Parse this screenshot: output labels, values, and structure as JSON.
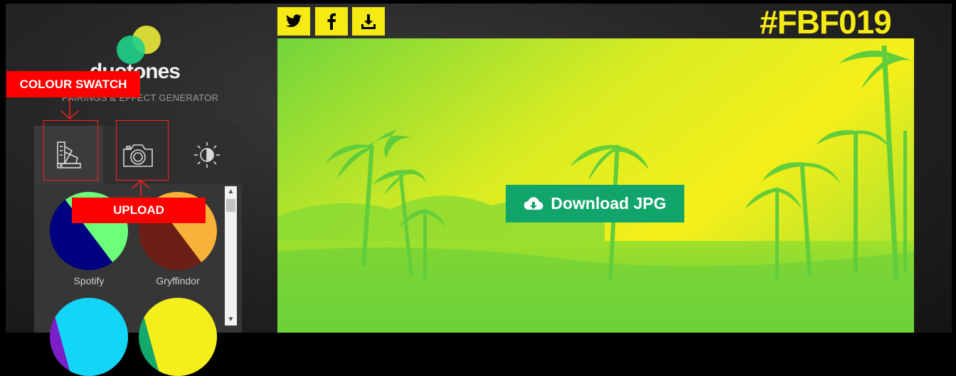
{
  "sidebar": {
    "logo": {
      "brand": "duotones",
      "tagline": "PAIRINGS & EFFECT GENERATOR"
    },
    "tabs": [
      {
        "icon": "colour-swatch-icon",
        "active": true
      },
      {
        "icon": "camera-icon",
        "active": false
      },
      {
        "icon": "brightness-icon",
        "active": false
      }
    ],
    "swatches": [
      {
        "name": "Spotify",
        "colors": [
          "#000080",
          "#6cff7a"
        ]
      },
      {
        "name": "Gryffindor",
        "colors": [
          "#6b1f17",
          "#f7b23a"
        ]
      },
      {
        "name": "",
        "colors": [
          "#7b1fc8",
          "#12d6f5"
        ]
      },
      {
        "name": "",
        "colors": [
          "#14a86a",
          "#f5ee1a"
        ]
      }
    ]
  },
  "annotations": {
    "colour_swatch": "COLOUR SWATCH",
    "upload": "UPLOAD",
    "color": "#ff0000"
  },
  "toolbar": {
    "share": [
      {
        "icon": "twitter-icon"
      },
      {
        "icon": "facebook-icon"
      },
      {
        "icon": "download-icon"
      }
    ],
    "hashtag": "#FBF019",
    "accent": "#FBF019"
  },
  "preview": {
    "download_label": "Download JPG",
    "button_color": "#11a46b",
    "duotone": [
      "#5fd33a",
      "#fbf019"
    ]
  }
}
